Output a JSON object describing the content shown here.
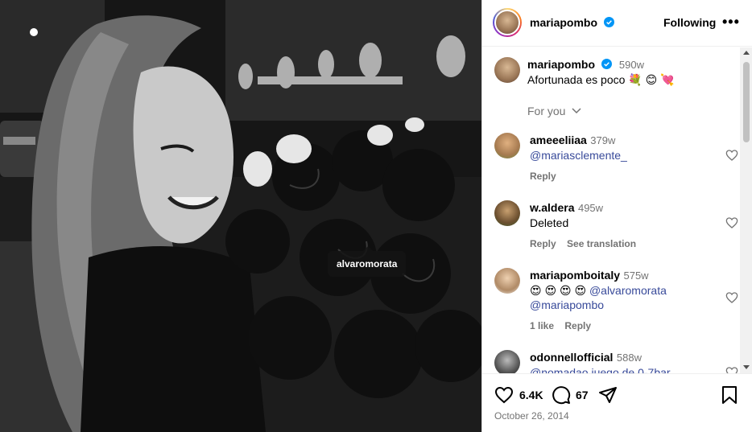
{
  "photo": {
    "tag_label": "alvaromorata"
  },
  "post": {
    "username": "mariapombo",
    "follow_label": "Following",
    "more_label": "•••",
    "caption_time": "590w",
    "caption_text": "Afortunada es poco 💐 😊 💘",
    "for_you_label": "For you"
  },
  "comments": [
    {
      "username": "ameeeliiaa",
      "time": "379w",
      "text": "@mariasclemente_",
      "reply_label": "Reply"
    },
    {
      "username": "w.aldera",
      "time": "495w",
      "text": "Deleted",
      "reply_label": "Reply",
      "see_translation_label": "See translation"
    },
    {
      "username": "mariapomboitaly",
      "time": "575w",
      "emoji": "😍 😍 😍 😍",
      "mention1": "@alvaromorata",
      "mention2": "@mariapombo",
      "likes_label": "1 like",
      "reply_label": "Reply"
    },
    {
      "username": "odonnellofficial",
      "time": "588w",
      "text": "@nomadao juego de 0-7bar"
    }
  ],
  "actions": {
    "likes_count": "6.4K",
    "comments_count": "67"
  },
  "date_label": "October 26, 2014",
  "colors": {
    "verified_blue": "#0095f6",
    "mention_blue": "#384a9a",
    "secondary_text": "#737373"
  },
  "icons": [
    "heart-icon",
    "comment-icon",
    "share-icon",
    "bookmark-icon",
    "verified-icon",
    "chevron-down-icon"
  ]
}
